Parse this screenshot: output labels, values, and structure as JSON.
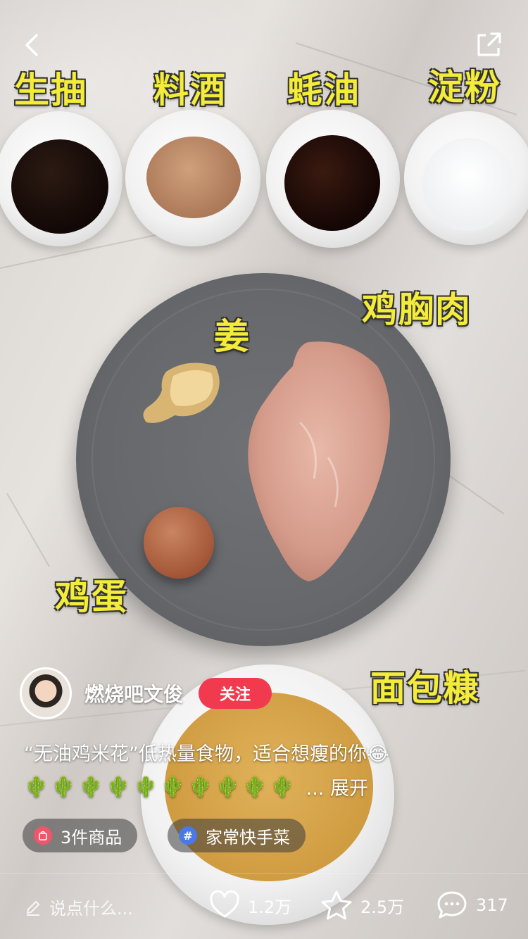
{
  "ingredients": {
    "top": [
      "生抽",
      "料酒",
      "蚝油",
      "淀粉"
    ],
    "ginger": "姜",
    "chicken": "鸡胸肉",
    "egg": "鸡蛋",
    "breadcrumbs": "面包糠"
  },
  "author": {
    "name": "燃烧吧文俊",
    "follow_label": "关注"
  },
  "caption": {
    "text": "“无油鸡米花”低热量食物，适合想瘦的你😂",
    "emoji_row": "🌵🌵🌵🌵🌵🌵🌵🌵🌵🌵",
    "expand_label": "... 展开"
  },
  "chips": {
    "products": "3件商品",
    "topic": "家常快手菜"
  },
  "bottom": {
    "comment_placeholder": "说点什么...",
    "likes": "1.2万",
    "favorites": "2.5万",
    "comments": "317"
  },
  "colors": {
    "label_yellow": "#f4ec3a",
    "follow_red": "#f23a4f",
    "product_icon": "#f0566a",
    "topic_icon": "#4a78e8"
  },
  "icons": {
    "back": "chevron-left-icon",
    "share": "share-icon",
    "like": "heart-icon",
    "favorite": "star-icon",
    "comment": "comment-bubble-icon",
    "edit": "pencil-icon"
  }
}
